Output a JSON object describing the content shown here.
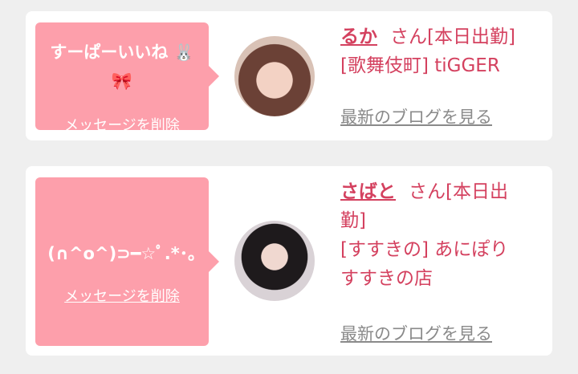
{
  "messages": [
    {
      "text_line1": "すーぱーいいね",
      "bunny": "🐰",
      "bow": "🎀",
      "delete_label": "メッセージを削除",
      "name": "るか",
      "suffix": "さん[本日出勤]",
      "shop": "[歌舞伎町] tiGGER",
      "blog_label": "最新のブログを見る"
    },
    {
      "text": "(∩^o^)⊃━☆ﾟ.*･｡",
      "delete_label": "メッセージを削除",
      "name": "さばと",
      "suffix_line1": "さん[本日出",
      "suffix_line2": "勤]",
      "shop_line1": "[すすきの] あにぽり",
      "shop_line2": "すすきの店",
      "blog_label": "最新のブログを見る"
    }
  ],
  "colors": {
    "bubble": "#fd9fab",
    "accent": "#d4415f",
    "link_gray": "#8a8a8a",
    "background": "#efefef"
  }
}
